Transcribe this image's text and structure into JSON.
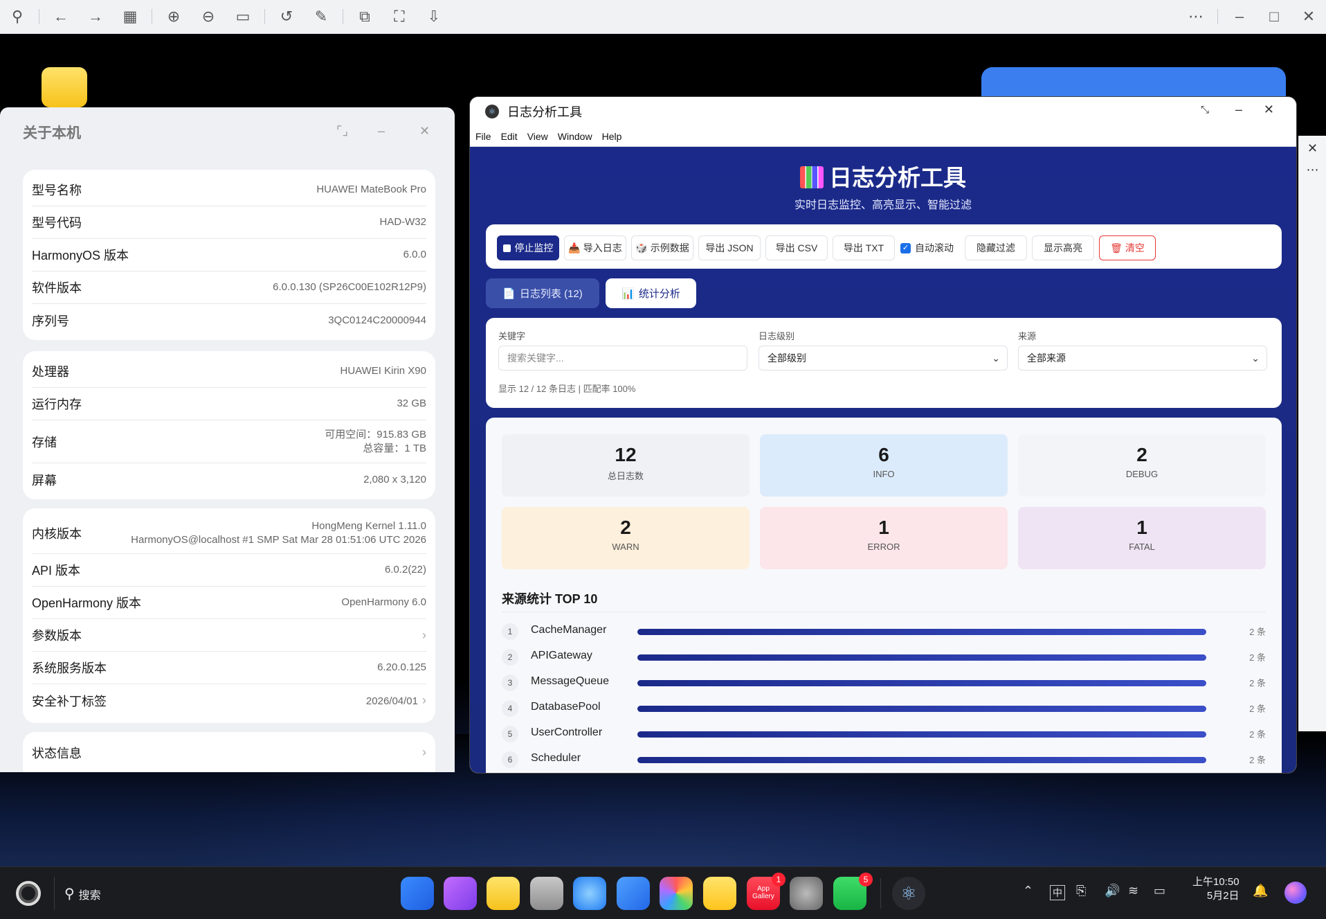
{
  "viewer": {
    "icons": [
      "pin-icon",
      "back-arrow-icon",
      "forward-arrow-icon",
      "grid-icon",
      "zoom-in-icon",
      "zoom-out-icon",
      "actual-size-icon",
      "rotate-icon",
      "edit-icon",
      "crop-icon",
      "fit-icon",
      "save-icon",
      "more-icon",
      "minimize-icon",
      "maximize-icon",
      "close-icon"
    ]
  },
  "about": {
    "title": "关于本机",
    "group1": [
      {
        "k": "型号名称",
        "v": "HUAWEI MateBook Pro"
      },
      {
        "k": "型号代码",
        "v": "HAD-W32"
      },
      {
        "k": "HarmonyOS 版本",
        "v": "6.0.0"
      },
      {
        "k": "软件版本",
        "v": "6.0.0.130 (SP26C00E102R12P9)"
      },
      {
        "k": "序列号",
        "v": "3QC0124C20000944"
      }
    ],
    "group2": [
      {
        "k": "处理器",
        "v": "HUAWEI Kirin X90"
      },
      {
        "k": "运行内存",
        "v": "32 GB"
      },
      {
        "k": "存储",
        "v1": "可用空间：915.83 GB",
        "v2": "总容量：1 TB"
      },
      {
        "k": "屏幕",
        "v": "2,080 x 3,120"
      }
    ],
    "group3": [
      {
        "k": "内核版本",
        "v1": "HongMeng Kernel 1.11.0",
        "v2": "HarmonyOS@localhost #1 SMP Sat Mar 28 01:51:06 UTC 2026"
      },
      {
        "k": "API 版本",
        "v": "6.0.2(22)"
      },
      {
        "k": "OpenHarmony 版本",
        "v": "OpenHarmony 6.0"
      },
      {
        "k": "参数版本",
        "v": ""
      },
      {
        "k": "系统服务版本",
        "v": "6.20.0.125"
      },
      {
        "k": "安全补丁标签",
        "v": "2026/04/01"
      }
    ],
    "group4": [
      {
        "k": "状态信息"
      }
    ]
  },
  "app": {
    "window_title": "日志分析工具",
    "menu": [
      "File",
      "Edit",
      "View",
      "Window",
      "Help"
    ],
    "header_title": "日志分析工具",
    "header_subtitle": "实时日志监控、高亮显示、智能过滤",
    "toolbar": {
      "stop": "停止监控",
      "import": "导入日志",
      "sample": "示例数据",
      "export_json": "导出 JSON",
      "export_csv": "导出 CSV",
      "export_txt": "导出 TXT",
      "autoscroll": "自动滚动",
      "hide_filter": "隐藏过滤",
      "show_highlight": "显示高亮",
      "clear": "清空"
    },
    "tabs": {
      "list": "日志列表 (12)",
      "stats": "统计分析"
    },
    "filters": {
      "keyword_label": "关键字",
      "keyword_placeholder": "搜索关键字...",
      "level_label": "日志级别",
      "level_value": "全部级别",
      "source_label": "来源",
      "source_value": "全部来源",
      "status": "显示 12 / 12 条日志  |  匹配率 100%"
    },
    "stats": [
      {
        "n": "12",
        "l": "总日志数",
        "bg": "#f0f1f5"
      },
      {
        "n": "6",
        "l": "INFO",
        "bg": "#dcebfb"
      },
      {
        "n": "2",
        "l": "DEBUG",
        "bg": "#f3f4f7"
      },
      {
        "n": "2",
        "l": "WARN",
        "bg": "#fdf0dc"
      },
      {
        "n": "1",
        "l": "ERROR",
        "bg": "#fce6ea"
      },
      {
        "n": "1",
        "l": "FATAL",
        "bg": "#efe4f4"
      }
    ],
    "source_title": "来源统计 TOP 10",
    "sources": [
      {
        "rank": "1",
        "name": "CacheManager",
        "count": "2 条",
        "fraction": 1
      },
      {
        "rank": "2",
        "name": "APIGateway",
        "count": "2 条",
        "fraction": 1
      },
      {
        "rank": "3",
        "name": "MessageQueue",
        "count": "2 条",
        "fraction": 1
      },
      {
        "rank": "4",
        "name": "DatabasePool",
        "count": "2 条",
        "fraction": 1
      },
      {
        "rank": "5",
        "name": "UserController",
        "count": "2 条",
        "fraction": 1
      },
      {
        "rank": "6",
        "name": "Scheduler",
        "count": "2 条",
        "fraction": 1
      }
    ]
  },
  "taskbar": {
    "search": "搜索",
    "badges": {
      "appgallery": "1",
      "wechat": "5"
    },
    "appgallery_label": "App\nGallery",
    "ime": "中",
    "time": "上午10:50",
    "date": "5月2日"
  }
}
